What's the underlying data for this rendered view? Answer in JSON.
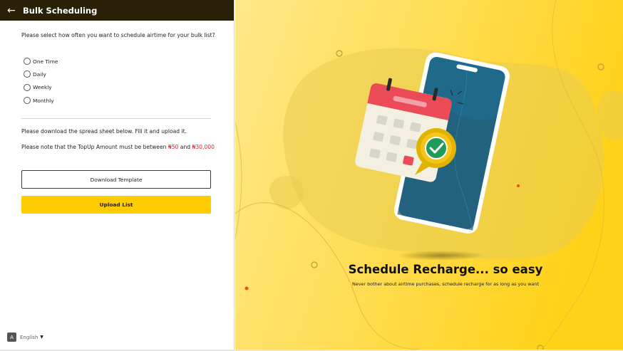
{
  "header": {
    "back_icon": "arrow-left-icon",
    "title": "Bulk Scheduling"
  },
  "form": {
    "question": "Please select how often you want to schedule airtime for your bulk list?",
    "frequency_options": [
      "One Time",
      "Daily",
      "Weekly",
      "Monthly"
    ],
    "download_note": "Please download the spread sheet below. Fill it and upload it.",
    "amount_note_prefix": "Please note that the TopUp Amount must be between",
    "amount_min": "₦50",
    "amount_joiner": "and",
    "amount_max": "₦30,000",
    "download_button": "Download Template",
    "upload_button": "Upload List"
  },
  "footer": {
    "language_icon": "translate-icon",
    "language": "English",
    "caret_icon": "caret-down-icon"
  },
  "promo": {
    "headline": "Schedule Recharge... so easy",
    "subline": "Never bother about airtime purchases, schedule recharge for as long as you want",
    "illustration": "phone-calendar-checkmark-illustration"
  },
  "colors": {
    "header_bg": "#2a2007",
    "accent_yellow": "#ffcc00",
    "amount_red": "#e0202e",
    "phone_screen": "#1f6a8a",
    "calendar_red": "#ea4b56",
    "check_green": "#1e9b57"
  }
}
